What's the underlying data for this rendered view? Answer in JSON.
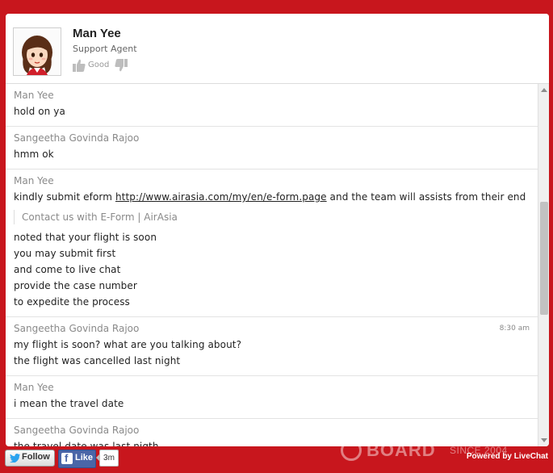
{
  "agent": {
    "name": "Man Yee",
    "role": "Support Agent",
    "rating_label": "Good"
  },
  "messages": [
    {
      "author": "Man Yee",
      "time": "",
      "lines": [
        "hold on ya"
      ]
    },
    {
      "author": "Sangeetha Govinda Rajoo",
      "time": "",
      "lines": [
        "hmm ok"
      ]
    },
    {
      "author": "Man Yee",
      "time": "",
      "link_line": {
        "before": "kindly submit eform ",
        "link": "http://www.airasia.com/my/en/e-form.page",
        "after": " and the team will assists from their end"
      },
      "link_preview": "Contact us with E-Form | AirAsia",
      "lines": [
        "noted that your flight is soon",
        "you may submit first",
        "and come to live chat",
        "provide the case number",
        "to expedite the process"
      ]
    },
    {
      "author": "Sangeetha Govinda Rajoo",
      "time": "8:30 am",
      "lines": [
        "my flight is soon? what are you talking about?",
        "the flight was cancelled last night"
      ]
    },
    {
      "author": "Man Yee",
      "time": "",
      "lines": [
        "i mean the travel date"
      ]
    },
    {
      "author": "Sangeetha Govinda Rajoo",
      "time": "",
      "lines": [
        "the travel date was last nigth"
      ]
    }
  ],
  "footer": {
    "follow_label": "Follow",
    "like_label": "Like",
    "like_count": "3m",
    "watermark_word": "BOARD",
    "watermark_since": "SINCE 2004",
    "powered_by": "Powered by LiveChat"
  },
  "colors": {
    "brand_red": "#c8161d",
    "facebook_blue": "#4a66a8",
    "twitter_blue": "#2aa3ef"
  },
  "icons": {
    "rate_good": "thumbs-up-icon",
    "rate_bad": "thumbs-down-icon",
    "follow": "twitter-bird-icon",
    "like": "facebook-icon",
    "watermark": "watermark-logo-icon"
  }
}
